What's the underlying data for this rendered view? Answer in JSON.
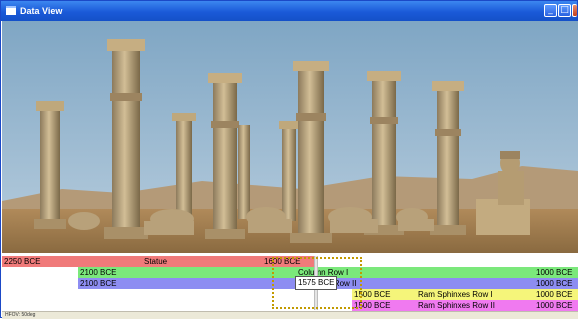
{
  "window": {
    "title": "Data View",
    "minimize_glyph": "_",
    "maximize_glyph": "□",
    "close_glyph": "✕"
  },
  "timeline": {
    "bars": [
      {
        "name": "statue",
        "color": "#f07a7a",
        "start_label": "2250 BCE",
        "title": "Statue",
        "end_label": "1600 BCE"
      },
      {
        "name": "column-row-1",
        "color": "#7be87b",
        "start_label": "2100 BCE",
        "title": "Column Row I",
        "end_label": "1000 BCE"
      },
      {
        "name": "column-row-2",
        "color": "#8d8df2",
        "start_label": "2100 BCE",
        "title": "Column Row II",
        "end_label": "1000 BCE"
      },
      {
        "name": "ram-sphinxes-row-1",
        "color": "#f5f57a",
        "start_label": "1500 BCE",
        "title": "Ram Sphinxes Row I",
        "end_label": "1000 BCE"
      },
      {
        "name": "ram-sphinxes-row-2",
        "color": "#f07af0",
        "start_label": "1500 BCE",
        "title": "Ram Sphinxes Row II",
        "end_label": "1000 BCE"
      }
    ],
    "cursor_label": "1575 BCE"
  },
  "status": {
    "text": "HFOV: 50deg"
  }
}
